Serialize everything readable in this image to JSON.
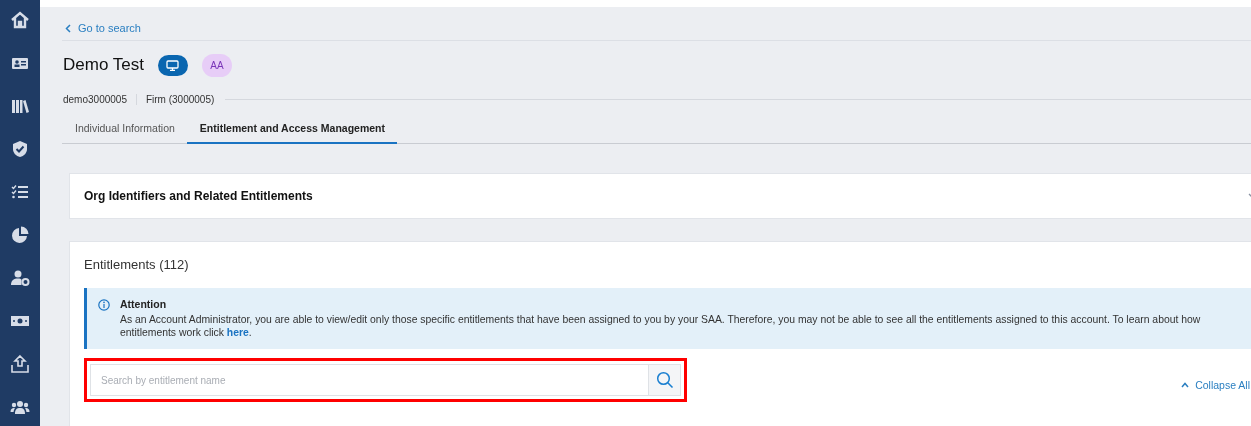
{
  "back_link": "Go to search",
  "header": {
    "title": "Demo Test",
    "badges": [
      {
        "kind": "icon"
      },
      {
        "kind": "text",
        "label": "AA"
      }
    ]
  },
  "identifiers": [
    "demo3000005",
    "Firm (3000005)"
  ],
  "tabs": [
    {
      "label": "Individual Information",
      "selected": false
    },
    {
      "label": "Entitlement and Access Management",
      "selected": true
    }
  ],
  "org_panel": {
    "title": "Org Identifiers and Related Entitlements",
    "expanded": false
  },
  "entitlements": {
    "title": "Entitlements (112)",
    "alert": {
      "title": "Attention",
      "text": "As an Account Administrator, you are able to view/edit only those specific entitlements that have been assigned to you by your SAA. Therefore, you may not be able to see all the entitlements assigned to this account. To learn about how entitlements work click",
      "link": "here",
      "after": "."
    },
    "search": {
      "placeholder": "Search by entitlement name",
      "highlighted": true
    },
    "collapse_all": "Collapse All"
  }
}
